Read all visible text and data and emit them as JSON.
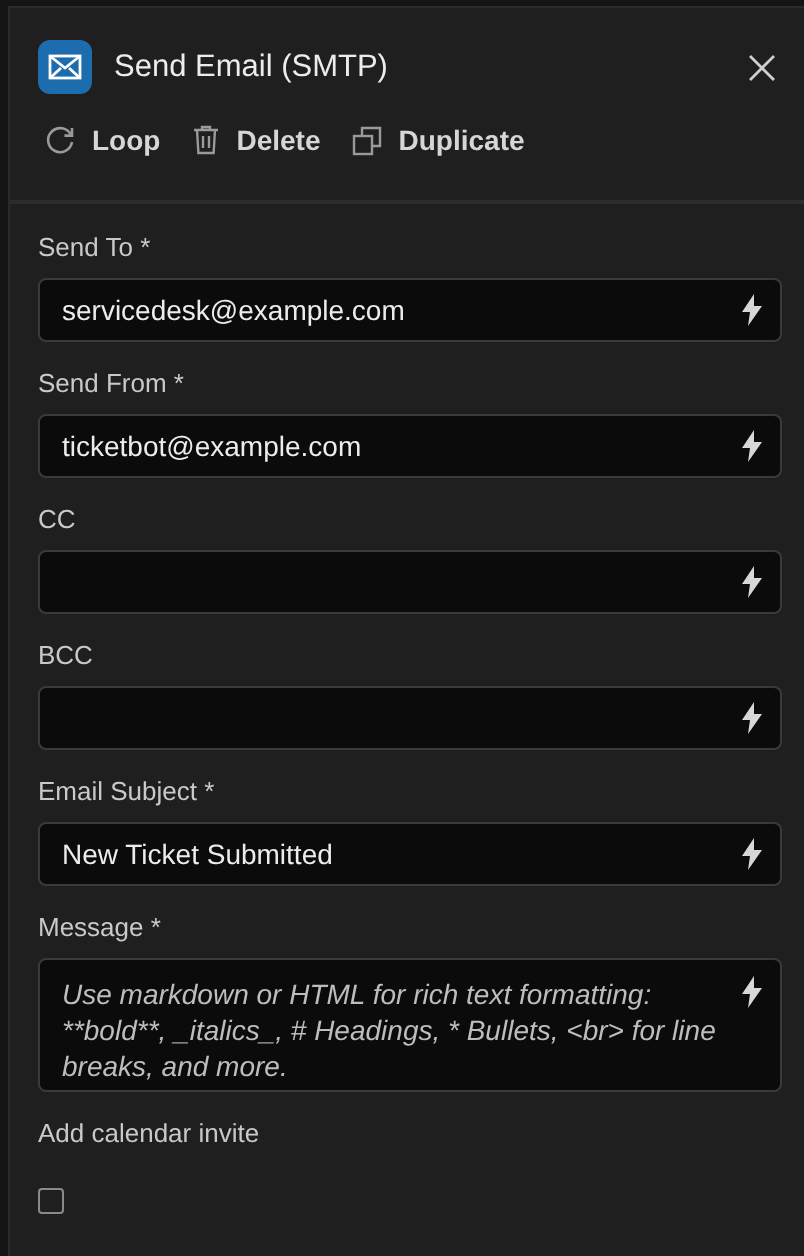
{
  "header": {
    "title": "Send Email (SMTP)"
  },
  "actions": [
    {
      "label": "Loop",
      "kind": "loop"
    },
    {
      "label": "Delete",
      "kind": "delete"
    },
    {
      "label": "Duplicate",
      "kind": "duplicate"
    }
  ],
  "fields": [
    {
      "label": "Send To *",
      "kind": "text",
      "value": "servicedesk@example.com"
    },
    {
      "label": "Send From *",
      "kind": "text",
      "value": "ticketbot@example.com"
    },
    {
      "label": "CC",
      "kind": "text"
    },
    {
      "label": "BCC",
      "kind": "text"
    },
    {
      "label": "Email Subject *",
      "kind": "text",
      "value": "New Ticket Submitted"
    },
    {
      "label": "Message *",
      "kind": "multiline",
      "placeholder": "Use markdown or HTML for rich text formatting: **bold**, _italics_, # Headings, * Bullets, <br> for line breaks, and more."
    }
  ],
  "calendar_invite": {
    "label": "Add calendar invite",
    "checked": false
  }
}
